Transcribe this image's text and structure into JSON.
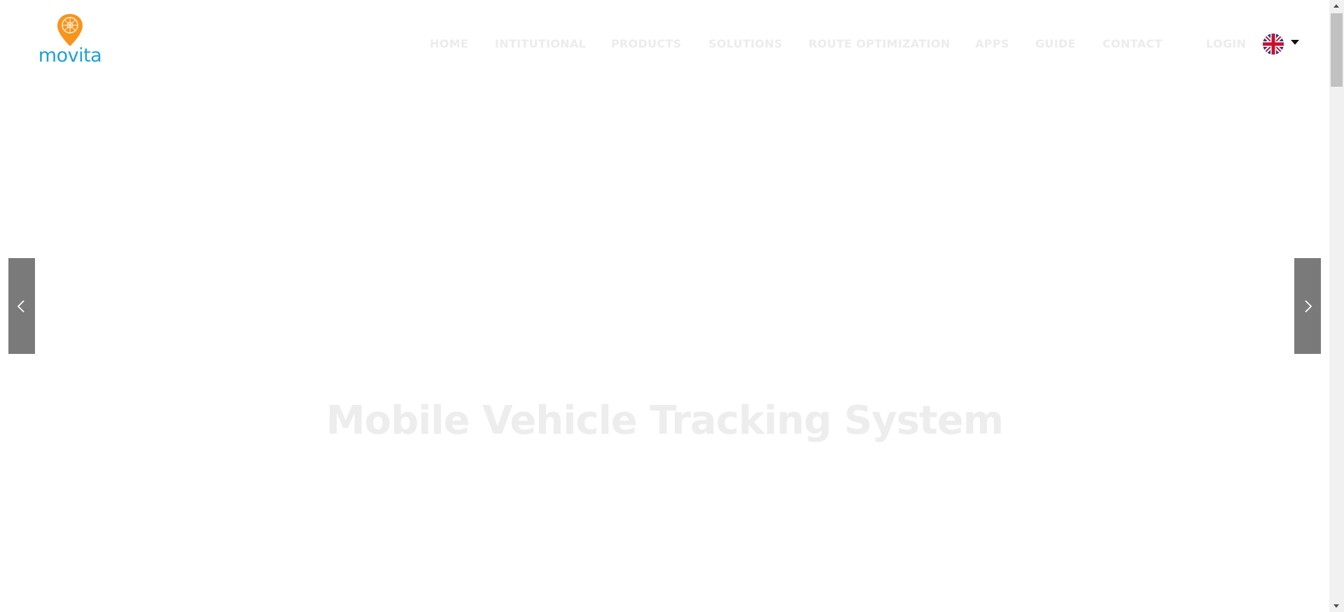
{
  "brand": {
    "name": "movita",
    "accent_color": "#f7941d",
    "text_color": "#1da1d6"
  },
  "nav": {
    "items": [
      {
        "label": "HOME"
      },
      {
        "label": "INTITUTIONAL"
      },
      {
        "label": "PRODUCTS"
      },
      {
        "label": "SOLUTIONS"
      },
      {
        "label": "ROUTE OPTIMIZATION"
      },
      {
        "label": "APPS"
      },
      {
        "label": "GUIDE"
      },
      {
        "label": "CONTACT"
      },
      {
        "label": "LOGIN"
      }
    ],
    "language_icon": "uk-flag-icon"
  },
  "slider": {
    "prev_icon": "chevron-left-icon",
    "next_icon": "chevron-right-icon"
  },
  "hero": {
    "title": "Mobile Vehicle Tracking System"
  }
}
